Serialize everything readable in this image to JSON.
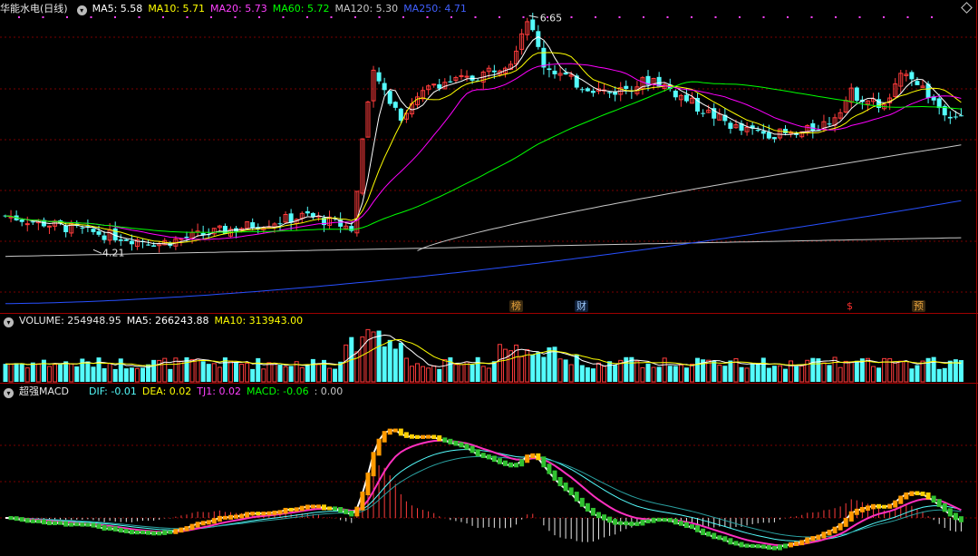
{
  "header": {
    "stock_title": "华能水电(日线)",
    "ma5": "MA5: 5.58",
    "ma10": "MA10: 5.71",
    "ma20": "MA20: 5.73",
    "ma60": "MA60: 5.72",
    "ma120": "MA120: 5.30",
    "ma250": "MA250: 4.71"
  },
  "volume_header": {
    "volume": "VOLUME: 254948.95",
    "ma5": "MA5: 266243.88",
    "ma10": "MA10: 313943.00"
  },
  "macd_header": {
    "title": "超强MACD",
    "dif": "DIF: -0.01",
    "dea": "DEA: 0.02",
    "tj1": "TJ1: 0.02",
    "macd": "MACD: -0.06",
    "extra": ": 0.00"
  },
  "markers": {
    "bang": "榜",
    "cai": "财",
    "dollar": "$",
    "yu": "预"
  },
  "colors": {
    "up": "#ff3c3c",
    "down": "#54fcfc",
    "ma5": "#ffffff",
    "ma10": "#ffff00",
    "ma20": "#ff00ff",
    "ma60": "#00ff00",
    "ma120": "#c8c8c8",
    "ma250": "#2850ff",
    "grid": "#7a0000"
  },
  "chart_data": {
    "type": "candlestick",
    "title": "华能水电(日线)",
    "price_annotations": {
      "high": "6.65",
      "low": "4.21"
    },
    "price_anchors": {
      "start": 4.55,
      "low_point": 4.21,
      "breakout_top": 6.15,
      "peak": 6.65,
      "plateau": 5.95,
      "secondary_high": 6.1,
      "end": 5.58
    },
    "moving_averages": [
      "MA5",
      "MA10",
      "MA20",
      "MA60",
      "MA120",
      "MA250"
    ],
    "last_values": {
      "MA5": 5.58,
      "MA10": 5.71,
      "MA20": 5.73,
      "MA60": 5.72,
      "MA120": 5.3,
      "MA250": 4.71
    },
    "volume_last": 254948.95,
    "volume_ma5": 266243.88,
    "volume_ma10": 313943.0,
    "macd_last": {
      "DIF": -0.01,
      "DEA": 0.02,
      "TJ1": 0.02,
      "MACD": -0.06
    }
  }
}
